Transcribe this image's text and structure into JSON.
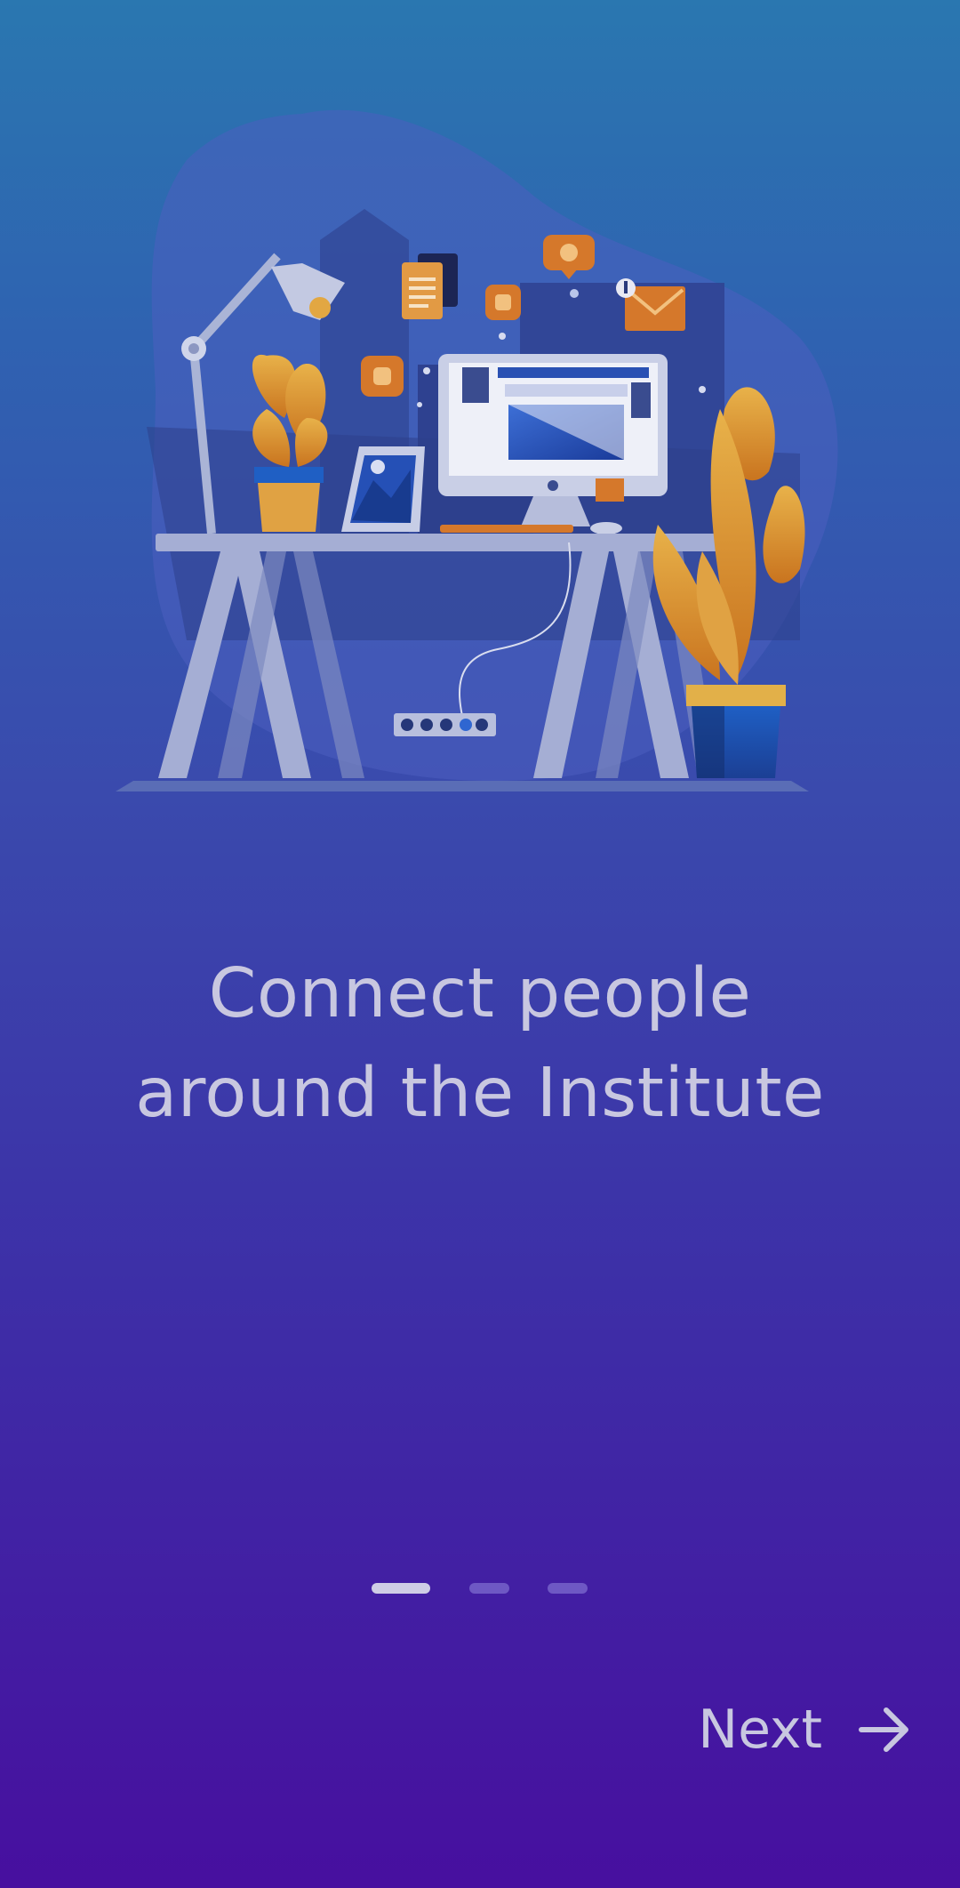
{
  "onboarding": {
    "headline_line1": "Connect people",
    "headline_line2": "around the Institute",
    "pager": {
      "total": 3,
      "active_index": 0
    },
    "next_label": "Next",
    "next_icon": "arrow-right-icon",
    "illustration": "workspace-desk-illustration"
  },
  "colors": {
    "bg_top": "#2a77b0",
    "bg_bottom": "#470f9f",
    "text": "#c8c7e0",
    "accent_orange": "#e08a2e",
    "desk": "#9aa3c9"
  }
}
